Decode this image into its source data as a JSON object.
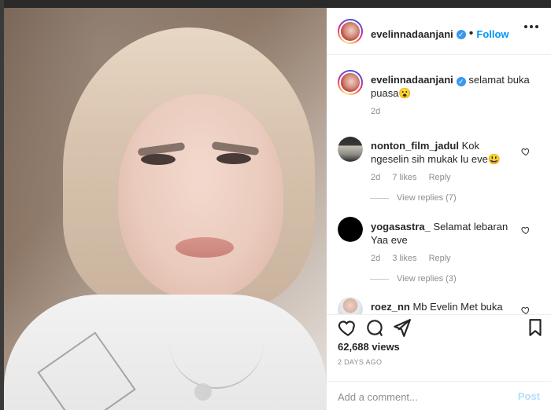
{
  "colors": {
    "accent": "#0095f6",
    "muted": "#8e8e8e",
    "text": "#262626",
    "post_disabled": "#b2dffc"
  },
  "header": {
    "username": "evelinnadaanjani",
    "verified_icon": "verified-badge-icon",
    "dot": "•",
    "follow_label": "Follow",
    "more_icon": "more-options-icon"
  },
  "caption": {
    "username": "evelinnadaanjani",
    "verified_icon": "verified-badge-icon",
    "text": "selamat buka puasa😮",
    "time": "2d"
  },
  "comments": [
    {
      "username": "nonton_film_jadul",
      "text": "Kok ngeselin sih mukak lu eve😃",
      "time": "2d",
      "likes": "7 likes",
      "reply_label": "Reply",
      "view_replies": "View replies (7)"
    },
    {
      "username": "yogasastra_",
      "text": "Selamat lebaran Yaa eve",
      "time": "2d",
      "likes": "3 likes",
      "reply_label": "Reply",
      "view_replies": "View replies (3)"
    },
    {
      "username": "roez_nn",
      "text": "Mb Evelin Met buka"
    }
  ],
  "actions": {
    "like_icon": "heart-icon",
    "comment_icon": "comment-icon",
    "share_icon": "share-icon",
    "save_icon": "bookmark-icon"
  },
  "stats": {
    "views": "62,688 views",
    "timestamp": "2 DAYS AGO"
  },
  "composer": {
    "placeholder": "Add a comment...",
    "post_label": "Post"
  }
}
